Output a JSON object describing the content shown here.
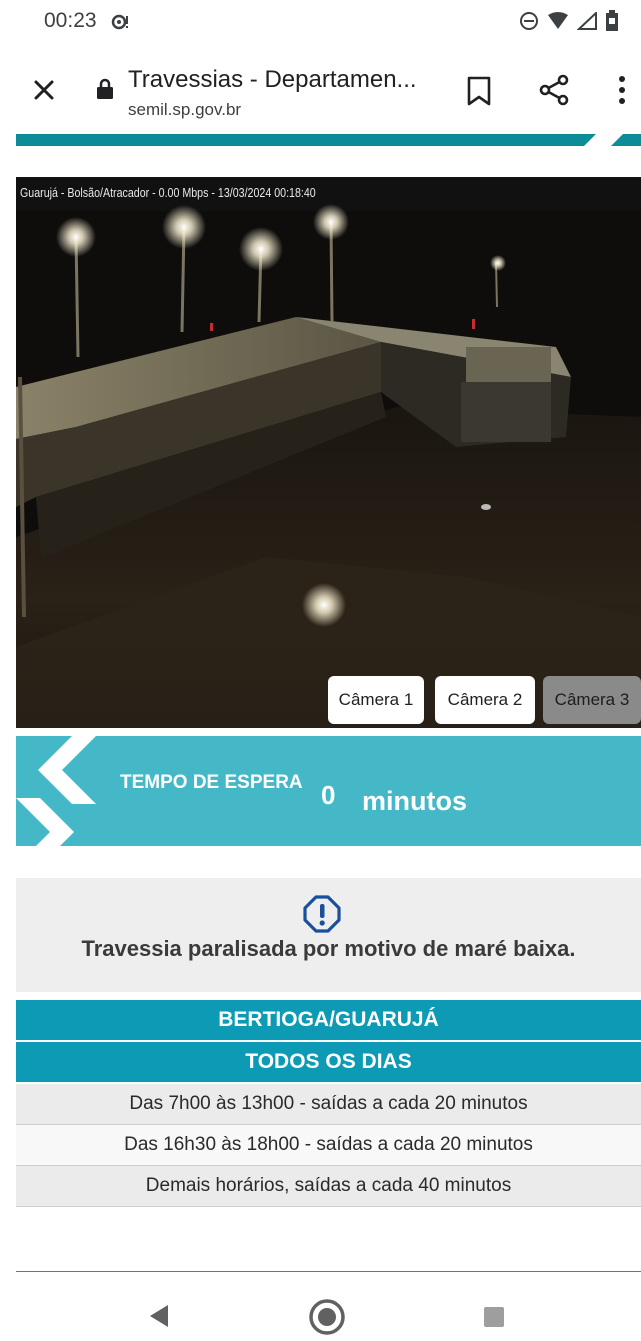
{
  "status_bar": {
    "time": "00:23"
  },
  "browser": {
    "title": "Travessias - Departamen...",
    "url": "semil.sp.gov.br"
  },
  "camera": {
    "caption": "Guarujá - Bolsão/Atracador - 0.00 Mbps - 13/03/2024 00:18:40",
    "buttons": [
      {
        "label": "Câmera 1",
        "state": "available"
      },
      {
        "label": "Câmera 2",
        "state": "available"
      },
      {
        "label": "Câmera 3",
        "state": "selected"
      }
    ]
  },
  "wait": {
    "label": "TEMPO DE ESPERA",
    "value": "0",
    "unit": "minutos"
  },
  "alert": {
    "message": "Travessia paralisada por motivo de maré baixa."
  },
  "schedule": {
    "route": "BERTIOGA/GUARUJÁ",
    "period": "TODOS OS DIAS",
    "rows": [
      "Das 7h00 às 13h00 - saídas a cada 20 minutos",
      "Das 16h30 às 18h00 - saídas a cada 20 minutos",
      "Demais horários, saídas a cada 40 minutos"
    ]
  },
  "colors": {
    "teal_dark": "#0c9ab4",
    "teal_light": "#45b8c8",
    "alert_blue": "#1a4f9c"
  }
}
